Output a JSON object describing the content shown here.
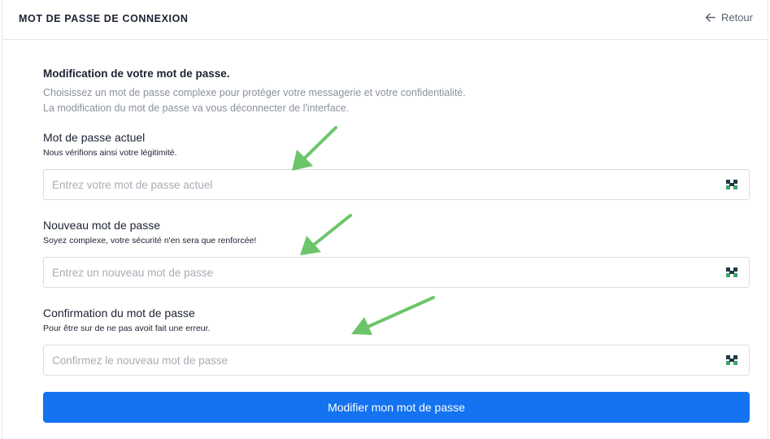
{
  "header": {
    "title": "MOT DE PASSE DE CONNEXION",
    "back_label": "Retour"
  },
  "section": {
    "title": "Modification de votre mot de passe.",
    "description_line1": "Choisissez un mot de passe complexe pour protéger votre messagerie et votre confidentialité.",
    "description_line2": "La modification du mot de passe va vous déconnecter de l'interface."
  },
  "fields": [
    {
      "label": "Mot de passe actuel",
      "hint": "Nous vérifions ainsi votre légitimité.",
      "placeholder": "Entrez votre mot de passe actuel",
      "value": ""
    },
    {
      "label": "Nouveau mot de passe",
      "hint": "Soyez complexe, votre sécurité n'en sera que renforcée!",
      "placeholder": "Entrez un nouveau mot de passe",
      "value": ""
    },
    {
      "label": "Confirmation du mot de passe",
      "hint": "Pour être sur de ne pas avoit fait une erreur.",
      "placeholder": "Confirmez le nouveau mot de passe",
      "value": ""
    }
  ],
  "submit_label": "Modifier mon mot de passe",
  "icons": {
    "back": "arrow-left-icon",
    "field_toggle": "password-key-icon"
  },
  "colors": {
    "primary": "#1473f0",
    "annotation_arrow": "#6cc56a",
    "icon_dark": "#1f3a44",
    "icon_accent": "#3fa36b"
  }
}
